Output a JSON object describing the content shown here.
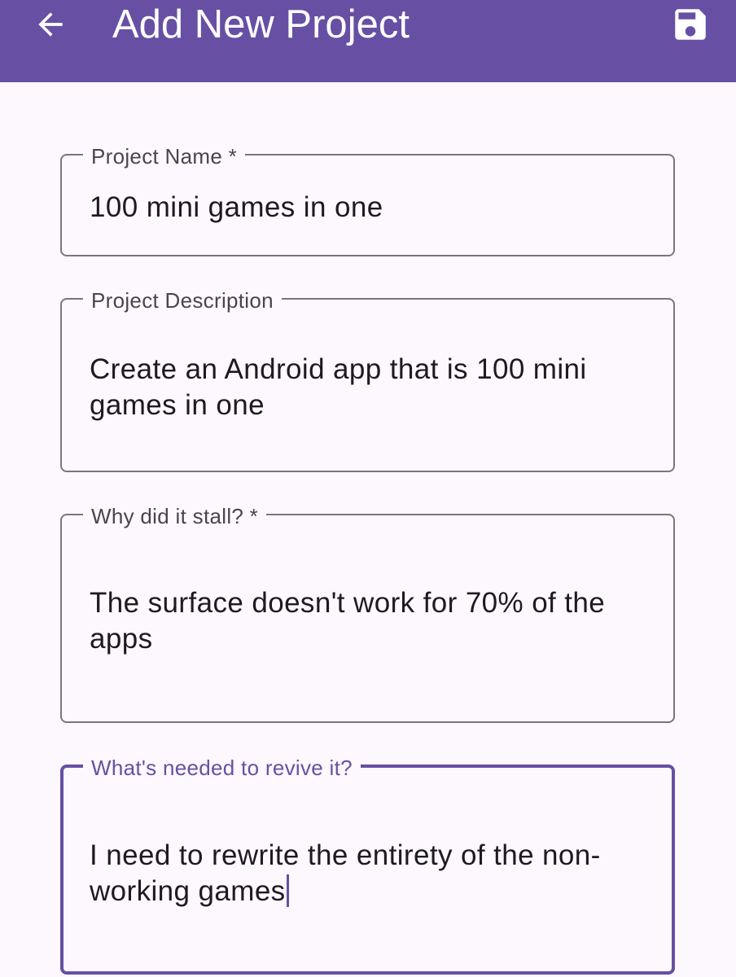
{
  "app_bar": {
    "title": "Add New Project",
    "back_icon": "arrow-back-icon",
    "save_icon": "save-icon",
    "background_color": "#6750a4"
  },
  "form": {
    "project_name": {
      "label": "Project Name *",
      "value": "100 mini games in one"
    },
    "project_description": {
      "label": "Project Description",
      "value": "Create an Android app that is 100 mini games in one"
    },
    "why_stalled": {
      "label": "Why did it stall? *",
      "value": "The surface doesn't work for 70% of the apps"
    },
    "revive_needs": {
      "label": "What's needed to revive it?",
      "value": "I need to rewrite the entirety of the non-working games",
      "focused": true
    }
  },
  "colors": {
    "accent": "#6750a4",
    "outline": "#7a757f",
    "text": "#1d1b20",
    "label": "#49454f",
    "background": "#fdf8fd"
  }
}
